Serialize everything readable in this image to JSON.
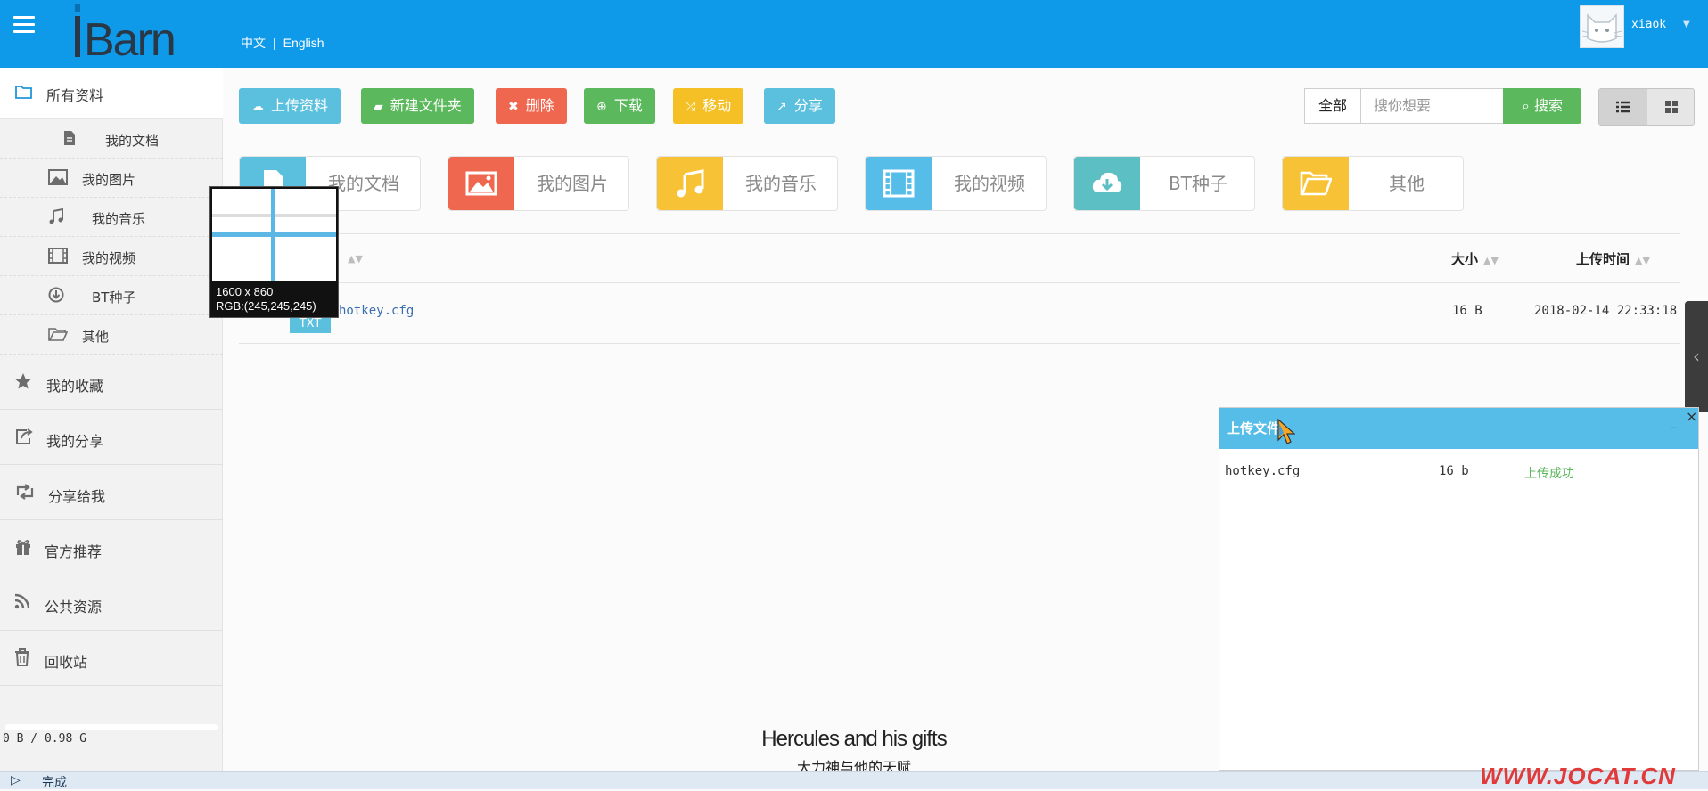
{
  "topbar": {
    "logo": "iBarn",
    "lang_zh": "中文",
    "lang_sep": "|",
    "lang_en": "English",
    "username": "xiaok",
    "bg_color": "#0f9ae9"
  },
  "sidebar": {
    "top": {
      "label": "所有资料",
      "icon": "folder-open-icon"
    },
    "sub_items": [
      {
        "label": "我的文档",
        "icon": "file-icon"
      },
      {
        "label": "我的图片",
        "icon": "picture-icon"
      },
      {
        "label": "我的音乐",
        "icon": "music-icon"
      },
      {
        "label": "我的视频",
        "icon": "film-icon"
      },
      {
        "label": "BT种子",
        "icon": "download-circle-icon"
      },
      {
        "label": "其他",
        "icon": "folder-icon"
      }
    ],
    "main_items": [
      {
        "label": "我的收藏",
        "icon": "star-icon"
      },
      {
        "label": "我的分享",
        "icon": "share-icon"
      },
      {
        "label": "分享给我",
        "icon": "retweet-icon"
      },
      {
        "label": "官方推荐",
        "icon": "gift-icon"
      },
      {
        "label": "公共资源",
        "icon": "rss-icon"
      },
      {
        "label": "回收站",
        "icon": "trash-icon"
      }
    ],
    "quota": "0 B / 0.98 G"
  },
  "toolbar": {
    "upload": "上传资料",
    "new_folder": "新建文件夹",
    "delete": "删除",
    "download": "下载",
    "move": "移动",
    "share": "分享",
    "filter": "全部",
    "search_placeholder": "搜你想要",
    "search": "搜索"
  },
  "categories": [
    {
      "label": "我的文档",
      "color": "#5bc0de",
      "icon": "file-icon"
    },
    {
      "label": "我的图片",
      "color": "#f0674f",
      "icon": "picture-icon"
    },
    {
      "label": "我的音乐",
      "color": "#f7c236",
      "icon": "music-icon"
    },
    {
      "label": "我的视频",
      "color": "#55bde8",
      "icon": "film-icon"
    },
    {
      "label": "BT种子",
      "color": "#5bbfc4",
      "icon": "cloud-download-icon"
    },
    {
      "label": "其他",
      "color": "#f7c236",
      "icon": "folder-icon"
    }
  ],
  "table": {
    "col_size": "大小",
    "col_time": "上传时间",
    "rows": [
      {
        "name": "hotkey.cfg",
        "type": "TXT",
        "size": "16 B",
        "time": "2018-02-14 22:33:18"
      }
    ]
  },
  "magnifier": {
    "dims": "1600 x 860",
    "rgb": "RGB:(245,245,245)"
  },
  "upload_panel": {
    "title": "上传文件",
    "minimize": "–",
    "close": "×",
    "file": "hotkey.cfg",
    "size": "16 b",
    "status": "上传成功"
  },
  "subtitles": {
    "en": "Hercules and his gifts",
    "zh": "大力神与他的天赋"
  },
  "statusbar": {
    "text": "完成"
  },
  "watermark": "WWW.JOCAT.CN"
}
